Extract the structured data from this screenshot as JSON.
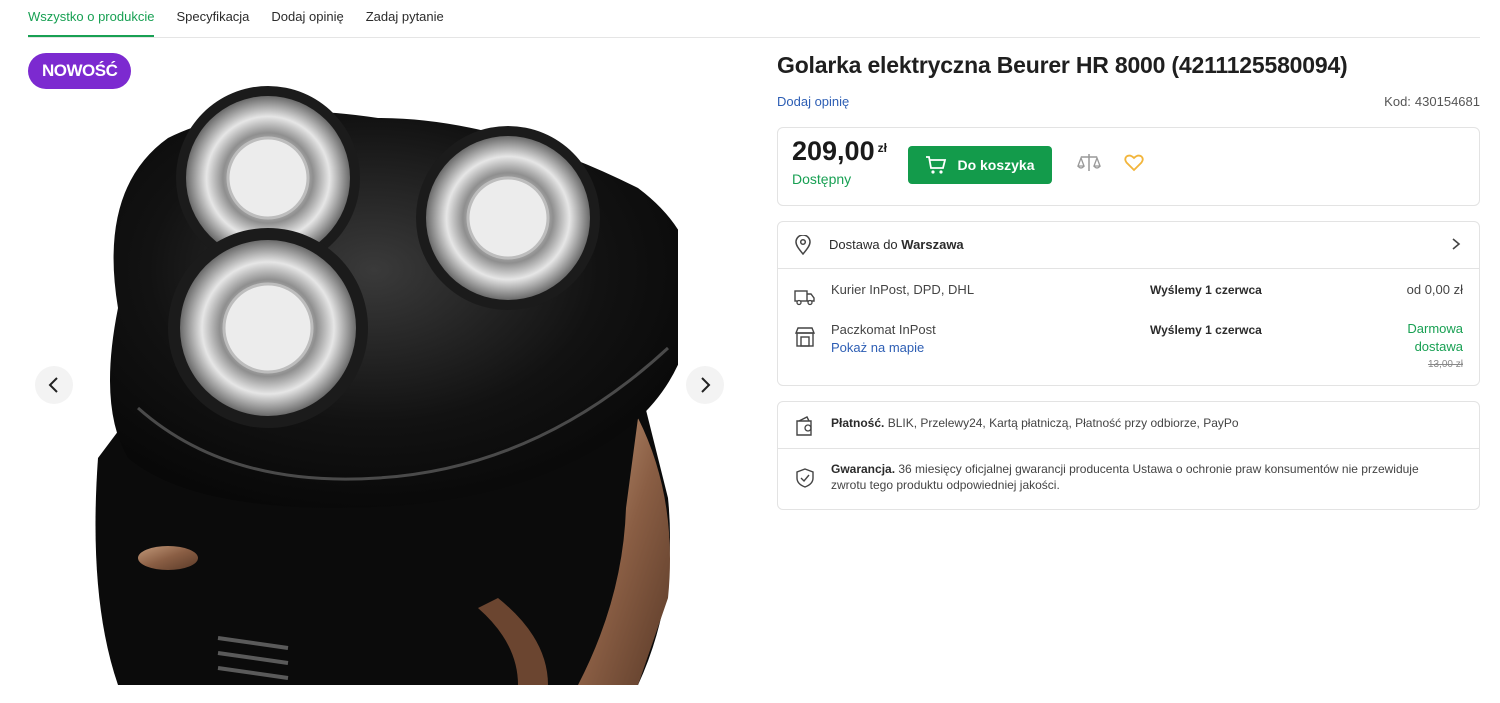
{
  "tabs": [
    {
      "label": "Wszystko o produkcie",
      "active": true
    },
    {
      "label": "Specyfikacja",
      "active": false
    },
    {
      "label": "Dodaj opinię",
      "active": false
    },
    {
      "label": "Zadaj pytanie",
      "active": false
    }
  ],
  "gallery": {
    "badge": "NOWOŚĆ",
    "prev_icon": "chevron-left-icon",
    "next_icon": "chevron-right-icon"
  },
  "product": {
    "title": "Golarka elektryczna Beurer HR 8000 (4211125580094)",
    "add_review": "Dodaj opinię",
    "code_label": "Kod:",
    "code_value": "430154681",
    "price": "209,00",
    "currency": "zł",
    "availability": "Dostępny",
    "cart_button": "Do koszyka"
  },
  "delivery": {
    "header_prefix": "Dostawa do",
    "city": "Warszawa",
    "options": [
      {
        "name": "Kurier InPost, DPD, DHL",
        "when": "Wyślemy 1 czerwca",
        "cost": "od 0,00 zł"
      },
      {
        "name": "Paczkomat InPost",
        "link": "Pokaż na mapie",
        "when": "Wyślemy 1 czerwca",
        "cost_free": "Darmowa dostawa",
        "old_cost": "13,00 zł"
      }
    ]
  },
  "payment": {
    "label": "Płatność.",
    "text": "BLIK, Przelewy24, Kartą płatniczą, Płatność przy odbiorze, PayPo"
  },
  "warranty": {
    "label": "Gwarancja.",
    "text": "36 miesięcy oficjalnej gwarancji producenta Ustawa o ochronie praw konsumentów nie przewiduje zwrotu tego produktu odpowiedniej jakości."
  },
  "colors": {
    "accent_green": "#139b4b",
    "badge_purple": "#7c2ad0",
    "link_blue": "#2d5eb4",
    "favorite_yellow": "#f2b53b"
  }
}
